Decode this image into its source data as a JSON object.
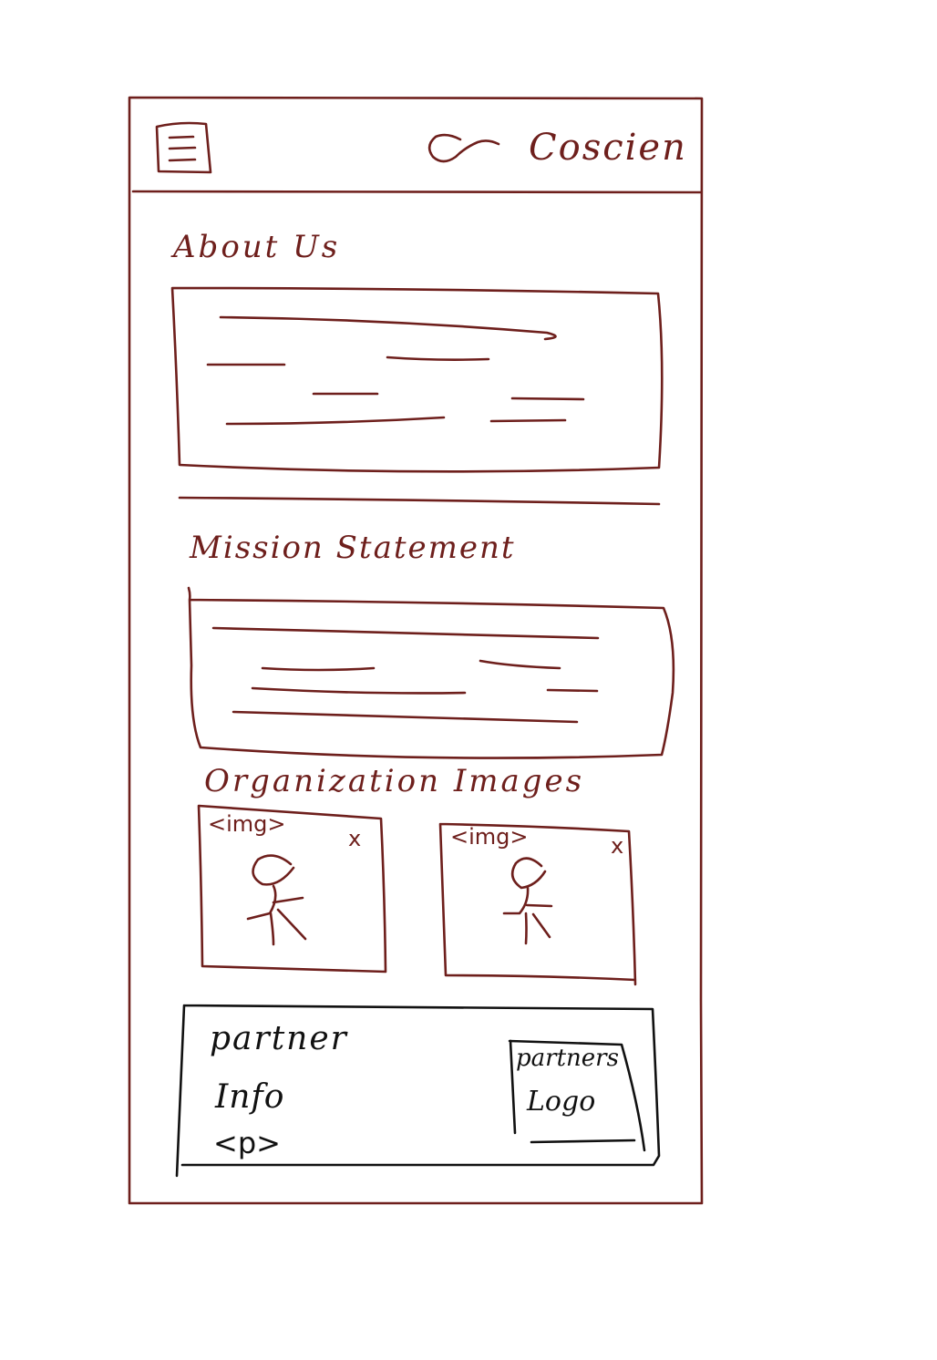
{
  "header": {
    "menu_icon": "hamburger-menu-icon",
    "logo_icon": "wave-logo-icon",
    "brand": "Coscien"
  },
  "about": {
    "heading": "About Us"
  },
  "mission": {
    "heading": "Mission Statement"
  },
  "images": {
    "heading": "Organization Images",
    "items": [
      {
        "tag": "<img>",
        "close": "x",
        "icon": "person-placeholder-icon"
      },
      {
        "tag": "<img>",
        "close": "x",
        "icon": "person-placeholder-icon"
      }
    ]
  },
  "partner": {
    "info_line1": "partner",
    "info_line2": "Info",
    "info_tag": "<p>",
    "logo_line1": "partners",
    "logo_line2": "Logo"
  },
  "colors": {
    "ink": "#6e1f1c",
    "text": "#111111",
    "background": "#ffffff"
  }
}
